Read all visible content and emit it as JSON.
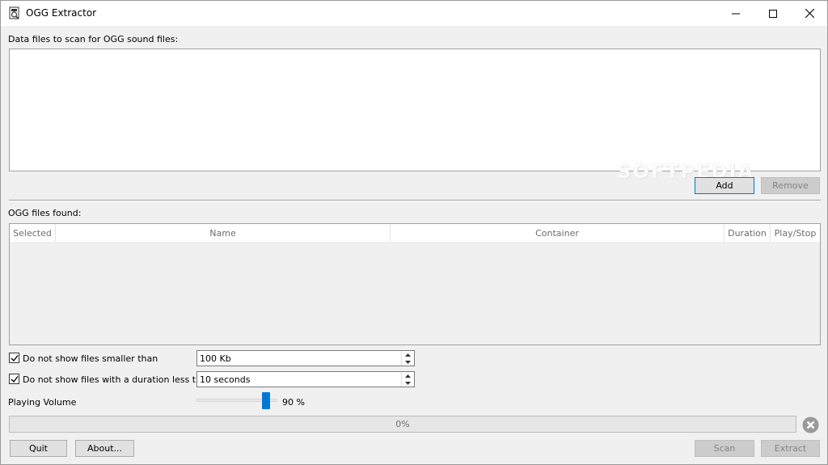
{
  "window": {
    "title": "OGG Extractor"
  },
  "data_files": {
    "label": "Data files to scan for OGG sound files:",
    "add_label": "Add",
    "remove_label": "Remove"
  },
  "ogg_files": {
    "label": "OGG files found:",
    "columns": [
      "Selected",
      "Name",
      "Container",
      "Duration",
      "Play/Stop"
    ]
  },
  "filters": {
    "size": {
      "label": "Do not show files smaller than",
      "checked": true,
      "value": "100 Kb"
    },
    "duration": {
      "label": "Do not show files with a duration less than",
      "checked": true,
      "value": "10 seconds"
    }
  },
  "volume": {
    "label": "Playing Volume",
    "level": 0.9,
    "display": "90 %"
  },
  "progress": {
    "fraction": 0,
    "display": "0%"
  },
  "buttons": {
    "quit_label": "Quit",
    "about_label": "About...",
    "scan_label": "Scan",
    "extract_label": "Extract"
  },
  "watermark": "SOFTPEDIA",
  "colors": {
    "accent": "#0078d7",
    "progress_fill": "#06b025"
  }
}
